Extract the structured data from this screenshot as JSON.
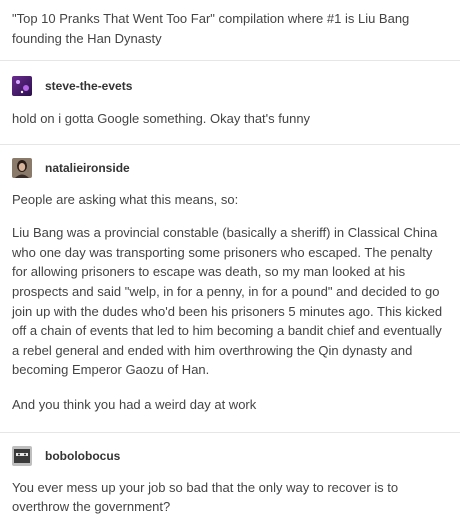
{
  "op": {
    "text": "\"Top 10 Pranks That Went Too Far\" compilation where #1 is Liu Bang founding the Han Dynasty"
  },
  "reblogs": [
    {
      "username": "steve-the-evets",
      "avatar_icon": "purple-space-avatar-icon",
      "paragraphs": [
        "hold on i gotta Google something. Okay that's funny"
      ]
    },
    {
      "username": "natalieironside",
      "avatar_icon": "portrait-photo-avatar-icon",
      "paragraphs": [
        "People are asking what this means, so:",
        "Liu Bang was a provincial constable (basically a sheriff) in Classical China who one day was transporting some prisoners who escaped. The penalty for allowing prisoners to escape was death, so my man looked at his prospects and said \"welp, in for a penny, in for a pound\" and decided to go join up with the dudes who'd been his prisoners 5 minutes ago. This kicked off a chain of events that led to him becoming a bandit chief and eventually a rebel general and ended with him overthrowing the Qin dynasty and becoming Emperor Gaozu of Han.",
        "And you think you had a weird day at work"
      ]
    },
    {
      "username": "bobolobocus",
      "avatar_icon": "masked-figure-avatar-icon",
      "paragraphs": [
        "You ever mess up your job so bad that the only way to recover is to overthrow the government?"
      ]
    }
  ],
  "colors": {
    "text": "#444444",
    "username": "#333333",
    "divider": "#e6e6e6"
  }
}
